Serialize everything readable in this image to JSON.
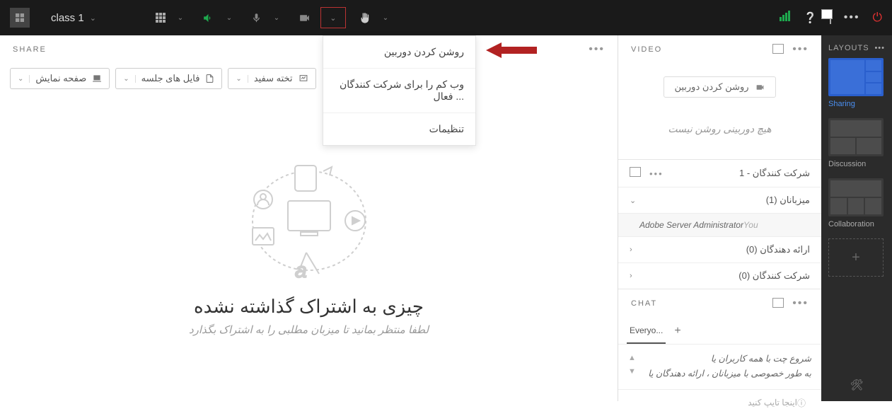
{
  "topbar": {
    "title": "class 1"
  },
  "camera_menu": {
    "item1": "روشن کردن دوربین",
    "item2": "وب کم را برای شرکت کنندگان فعال ...",
    "item3": "تنظیمات"
  },
  "share": {
    "header": "SHARE",
    "btn_screen": "صفحه نمایش",
    "btn_files": "فایل های جلسه",
    "btn_whiteboard": "تخته سفید",
    "empty_title": "چیزی به اشتراک گذاشته نشده",
    "empty_sub": "لطفا منتظر بمانید تا میزبان مطلبی را به اشتراک بگذارد"
  },
  "video": {
    "header": "VIDEO",
    "turn_on": "روشن کردن دوربین",
    "nocam": "هیچ دوربینی روشن نیست"
  },
  "attendees": {
    "header": "شرکت کنندگان  - 1",
    "hosts": "میزبانان (1)",
    "host_name": "Adobe Server Administrator",
    "host_you": "You",
    "presenters": "ارائه دهندگان (0)",
    "participants": "شرکت کنندگان (0)"
  },
  "chat": {
    "header": "CHAT",
    "tab": "Everyo...",
    "line1": "شروع چت با همه کاربران یا",
    "line2": "به طور خصوصی با میزبانان ، ارائه دهندگان یا",
    "placeholder": "اینجا تایپ کنید"
  },
  "layouts": {
    "title": "LAYOUTS",
    "sharing": "Sharing",
    "discussion": "Discussion",
    "collaboration": "Collaboration"
  }
}
